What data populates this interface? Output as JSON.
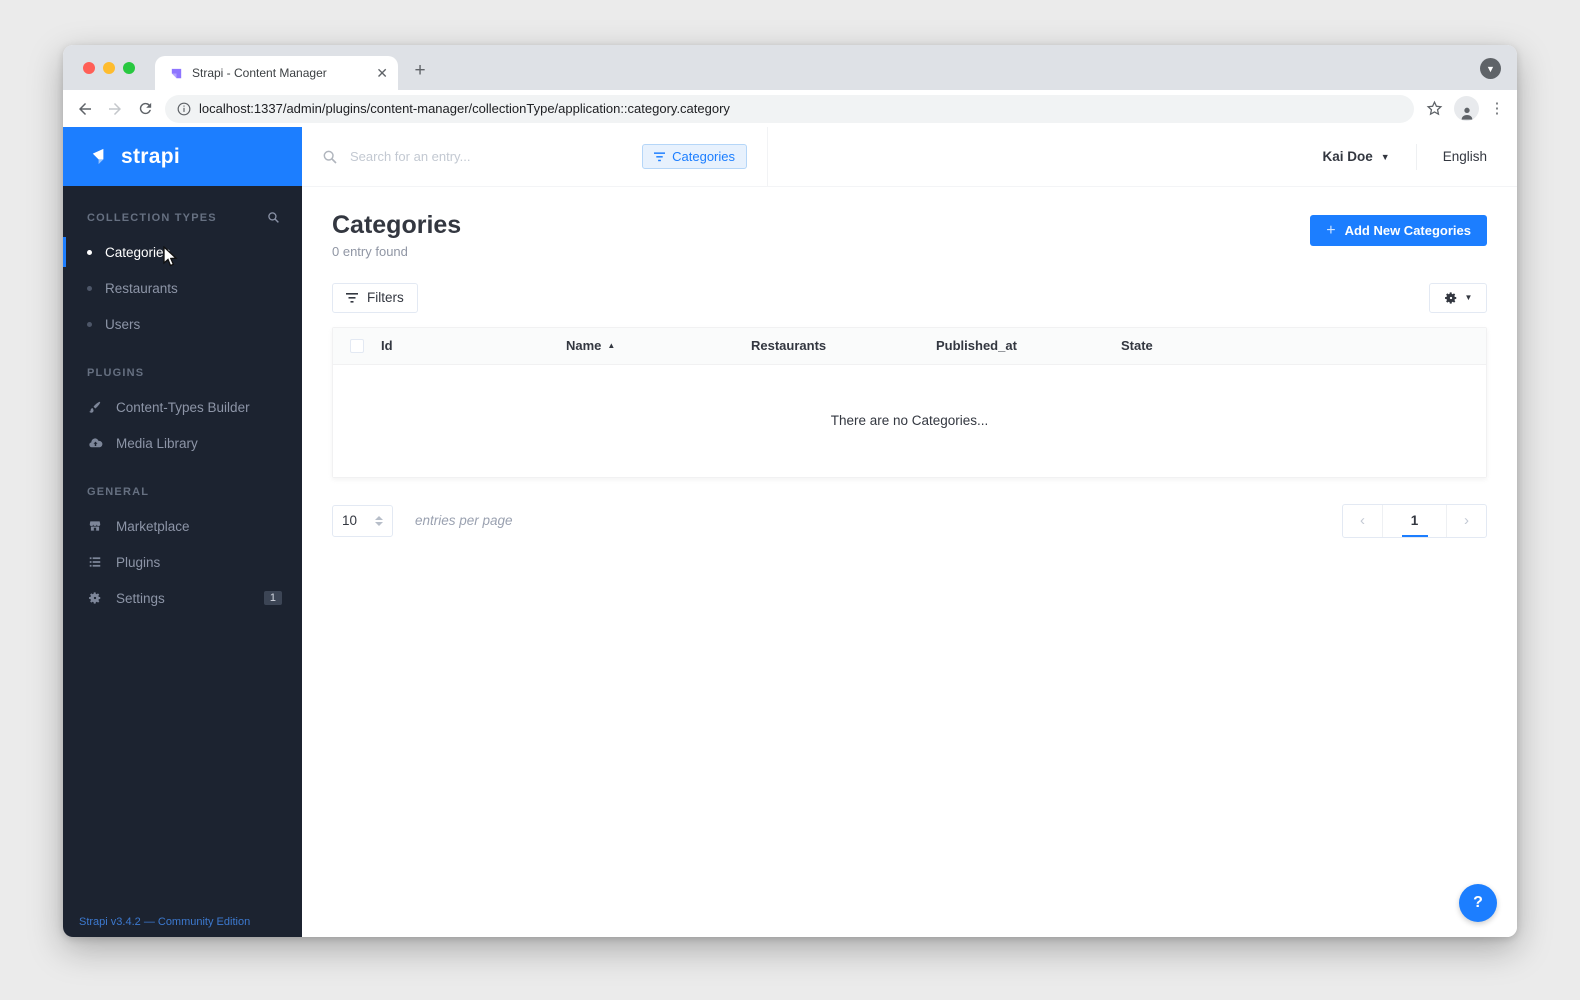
{
  "browser": {
    "tab_title": "Strapi - Content Manager",
    "url": "localhost:1337/admin/plugins/content-manager/collectionType/application::category.category"
  },
  "sidebar": {
    "logo_text": "strapi",
    "collection_types": {
      "title": "COLLECTION TYPES",
      "items": [
        {
          "label": "Categories",
          "active": true
        },
        {
          "label": "Restaurants",
          "active": false
        },
        {
          "label": "Users",
          "active": false
        }
      ]
    },
    "plugins_section": {
      "title": "PLUGINS",
      "items": [
        {
          "label": "Content-Types Builder",
          "icon": "paintbrush-icon"
        },
        {
          "label": "Media Library",
          "icon": "cloud-upload-icon"
        }
      ]
    },
    "general_section": {
      "title": "GENERAL",
      "items": [
        {
          "label": "Marketplace",
          "icon": "shop-icon"
        },
        {
          "label": "Plugins",
          "icon": "list-icon"
        },
        {
          "label": "Settings",
          "icon": "gear-icon",
          "badge": "1"
        }
      ]
    },
    "footer": "Strapi v3.4.2 — Community Edition"
  },
  "topbar": {
    "search_placeholder": "Search for an entry...",
    "filter_chip": "Categories",
    "user_name": "Kai Doe",
    "language": "English"
  },
  "page": {
    "title": "Categories",
    "subtitle": "0 entry found",
    "add_button": "Add New Categories",
    "filters_button": "Filters"
  },
  "table": {
    "columns": [
      "Id",
      "Name",
      "Restaurants",
      "Published_at",
      "State"
    ],
    "sorted_column": "Name",
    "sort_direction": "asc",
    "empty_message": "There are no Categories..."
  },
  "pagination": {
    "per_page": "10",
    "per_page_label": "entries per page",
    "current_page": "1"
  },
  "help": {
    "label": "?"
  },
  "colors": {
    "accent_blue": "#1c7eff",
    "sidebar_bg": "#1c2330",
    "chip_bg": "#e7f1fd"
  }
}
